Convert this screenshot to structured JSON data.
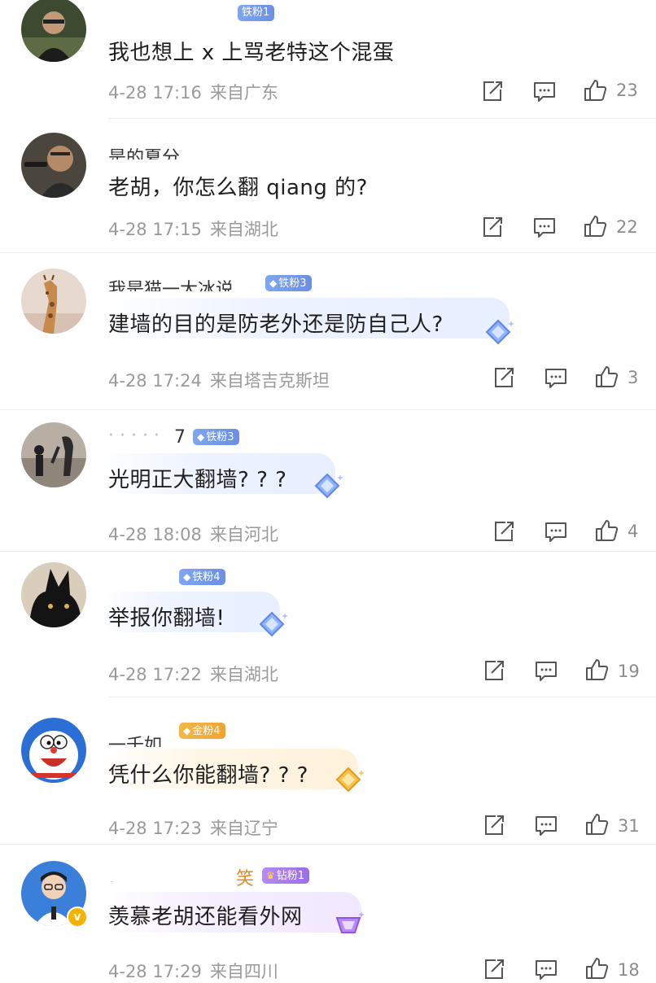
{
  "comments": [
    {
      "nickname": "",
      "badge": {
        "label": "铁粉1",
        "tier": "iron",
        "gem": "◆"
      },
      "text": "我也想上 x 上骂老特这个混蛋",
      "date": "4-28 17:16",
      "location": "来自广东",
      "likes": "23",
      "icons": {
        "share": "share-icon",
        "comment": "comment-icon",
        "like": "thumbs-up-icon"
      }
    },
    {
      "nickname": "",
      "badge": null,
      "text": "老胡，你怎么翻 qiang 的?",
      "date": "4-28 17:15",
      "location": "来自湖北",
      "likes": "22",
      "icons": {
        "share": "share-icon",
        "comment": "comment-icon",
        "like": "thumbs-up-icon"
      }
    },
    {
      "nickname": "",
      "badge": {
        "label": "铁粉3",
        "tier": "iron",
        "gem": "◆"
      },
      "text": "建墙的目的是防老外还是防自己人?",
      "date": "4-28 17:24",
      "location": "来自塔吉克斯坦",
      "likes": "3",
      "icons": {
        "share": "share-icon",
        "comment": "comment-icon",
        "like": "thumbs-up-icon"
      }
    },
    {
      "nickname": "7",
      "badge": {
        "label": "铁粉3",
        "tier": "iron",
        "gem": "◆"
      },
      "text": "光明正大翻墙? ? ?",
      "date": "4-28 18:08",
      "location": "来自河北",
      "likes": "4",
      "icons": {
        "share": "share-icon",
        "comment": "comment-icon",
        "like": "thumbs-up-icon"
      }
    },
    {
      "nickname": "",
      "badge": {
        "label": "铁粉4",
        "tier": "iron",
        "gem": "◆"
      },
      "text": "举报你翻墙!",
      "date": "4-28 17:22",
      "location": "来自湖北",
      "likes": "19",
      "icons": {
        "share": "share-icon",
        "comment": "comment-icon",
        "like": "thumbs-up-icon"
      }
    },
    {
      "nickname": "",
      "badge": {
        "label": "金粉4",
        "tier": "gold",
        "gem": "◆"
      },
      "text": "凭什么你能翻墙? ? ?",
      "date": "4-28 17:23",
      "location": "来自辽宁",
      "likes": "31",
      "icons": {
        "share": "share-icon",
        "comment": "comment-icon",
        "like": "thumbs-up-icon"
      }
    },
    {
      "nickname": "",
      "nick_suffix": "笑",
      "badge": {
        "label": "钻粉1",
        "tier": "diamond",
        "gem": "♛"
      },
      "text": "羡慕老胡还能看外网",
      "date": "4-28 17:29",
      "location": "来自四川",
      "likes": "18",
      "icons": {
        "share": "share-icon",
        "comment": "comment-icon",
        "like": "thumbs-up-icon"
      }
    }
  ],
  "colors": {
    "text": "#1f1f1f",
    "meta": "#9a9a9a",
    "iron_badge": "#6b8fe4",
    "gold_badge": "#f1a334",
    "diamond_badge": "#9a6ee8"
  }
}
